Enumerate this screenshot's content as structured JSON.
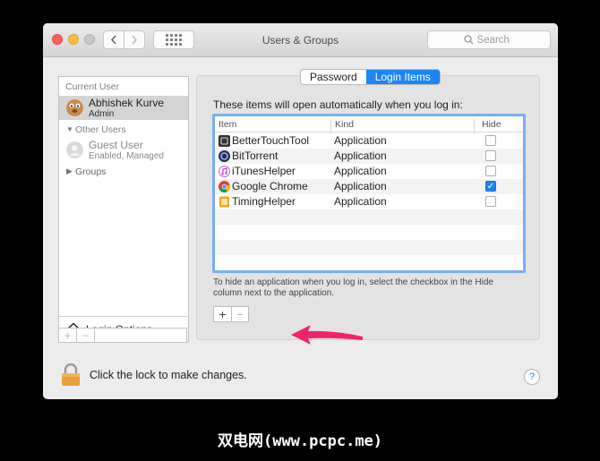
{
  "window": {
    "title": "Users & Groups",
    "search_placeholder": "Search"
  },
  "sidebar": {
    "current_user_header": "Current User",
    "current_user": {
      "name": "Abhishek Kurve",
      "role": "Admin"
    },
    "other_users_header": "Other Users",
    "guest_user": {
      "name": "Guest User",
      "status": "Enabled, Managed"
    },
    "groups_label": "Groups",
    "login_options_label": "Login Options",
    "add_label": "+",
    "remove_label": "−"
  },
  "tabs": [
    {
      "label": "Password",
      "active": false
    },
    {
      "label": "Login Items",
      "active": true
    }
  ],
  "login_items": {
    "intro": "These items will open automatically when you log in:",
    "columns": {
      "item": "Item",
      "kind": "Kind",
      "hide": "Hide"
    },
    "rows": [
      {
        "name": "BetterTouchTool",
        "kind": "Application",
        "hide": false,
        "icon": "bettertouchtool-icon"
      },
      {
        "name": "BitTorrent",
        "kind": "Application",
        "hide": false,
        "icon": "bittorrent-icon"
      },
      {
        "name": "iTunesHelper",
        "kind": "Application",
        "hide": false,
        "icon": "itunes-icon"
      },
      {
        "name": "Google Chrome",
        "kind": "Application",
        "hide": true,
        "icon": "chrome-icon"
      },
      {
        "name": "TimingHelper",
        "kind": "Application",
        "hide": false,
        "icon": "timing-icon"
      }
    ],
    "hint": "To hide an application when you log in, select the checkbox in the Hide column next to the application.",
    "add_label": "+",
    "remove_label": "−"
  },
  "footer": {
    "lock_text": "Click the lock to make changes.",
    "help_label": "?"
  },
  "watermark": "双电网(www.pcpc.me)",
  "colors": {
    "accent": "#1c85f5",
    "annotation_arrow": "#f0246e"
  }
}
